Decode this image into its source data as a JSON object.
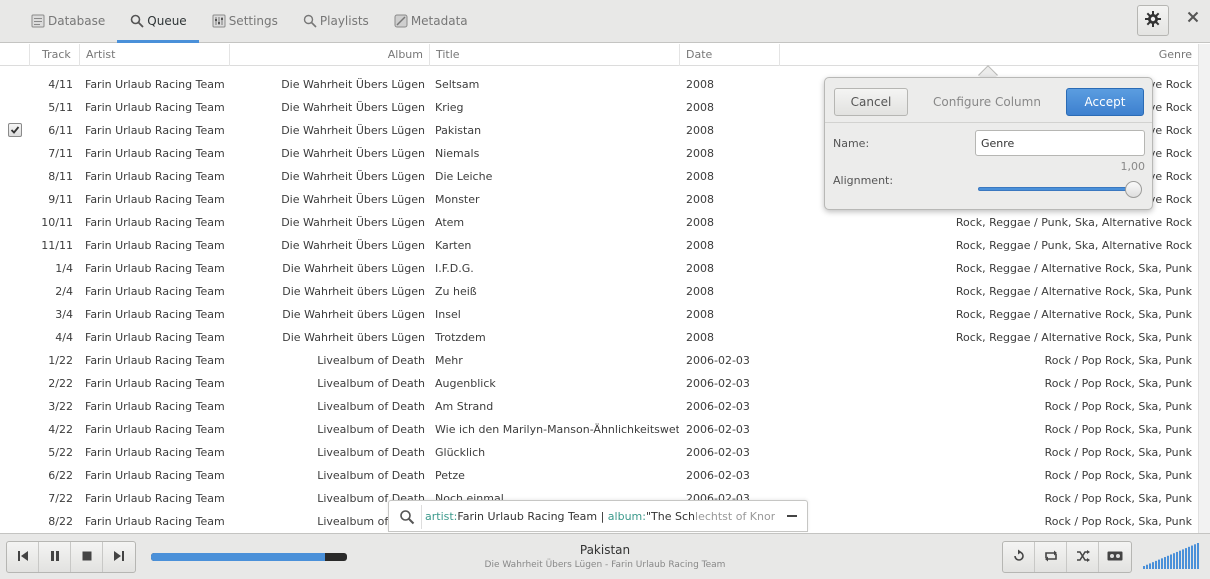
{
  "tabs": [
    {
      "label": "Database",
      "icon": "database-icon"
    },
    {
      "label": "Queue",
      "icon": "search-icon",
      "active": true
    },
    {
      "label": "Settings",
      "icon": "settings-icon"
    },
    {
      "label": "Playlists",
      "icon": "playlists-icon"
    },
    {
      "label": "Metadata",
      "icon": "metadata-icon"
    }
  ],
  "columns": {
    "track": "Track",
    "artist": "Artist",
    "album": "Album",
    "title": "Title",
    "date": "Date",
    "genre": "Genre"
  },
  "rows": [
    {
      "track": "4/11",
      "artist": "Farin Urlaub Racing Team",
      "album": "Die Wahrheit Übers Lügen",
      "title": "Seltsam",
      "date": "2008",
      "genre": "Rock, Reggae / Punk, Ska, Alternative Rock",
      "checked": false
    },
    {
      "track": "5/11",
      "artist": "Farin Urlaub Racing Team",
      "album": "Die Wahrheit Übers Lügen",
      "title": "Krieg",
      "date": "2008",
      "genre": "Rock, Reggae / Punk, Ska, Alternative Rock",
      "checked": false
    },
    {
      "track": "6/11",
      "artist": "Farin Urlaub Racing Team",
      "album": "Die Wahrheit Übers Lügen",
      "title": "Pakistan",
      "date": "2008",
      "genre": "Rock, Reggae / Punk, Ska, Alternative Rock",
      "checked": true
    },
    {
      "track": "7/11",
      "artist": "Farin Urlaub Racing Team",
      "album": "Die Wahrheit Übers Lügen",
      "title": "Niemals",
      "date": "2008",
      "genre": "Rock, Reggae / Punk, Ska, Alternative Rock",
      "checked": false
    },
    {
      "track": "8/11",
      "artist": "Farin Urlaub Racing Team",
      "album": "Die Wahrheit Übers Lügen",
      "title": "Die Leiche",
      "date": "2008",
      "genre": "Rock, Reggae / Punk, Ska, Alternative Rock",
      "checked": false
    },
    {
      "track": "9/11",
      "artist": "Farin Urlaub Racing Team",
      "album": "Die Wahrheit Übers Lügen",
      "title": "Monster",
      "date": "2008",
      "genre": "Rock, Reggae / Punk, Ska, Alternative Rock",
      "checked": false
    },
    {
      "track": "10/11",
      "artist": "Farin Urlaub Racing Team",
      "album": "Die Wahrheit Übers Lügen",
      "title": "Atem",
      "date": "2008",
      "genre": "Rock, Reggae / Punk, Ska, Alternative Rock",
      "checked": false
    },
    {
      "track": "11/11",
      "artist": "Farin Urlaub Racing Team",
      "album": "Die Wahrheit Übers Lügen",
      "title": "Karten",
      "date": "2008",
      "genre": "Rock, Reggae / Punk, Ska, Alternative Rock",
      "checked": false
    },
    {
      "track": "1/4",
      "artist": "Farin Urlaub Racing Team",
      "album": "Die Wahrheit übers Lügen",
      "title": "I.F.D.G.",
      "date": "2008",
      "genre": "Rock, Reggae / Alternative Rock, Ska, Punk",
      "checked": false
    },
    {
      "track": "2/4",
      "artist": "Farin Urlaub Racing Team",
      "album": "Die Wahrheit übers Lügen",
      "title": "Zu heiß",
      "date": "2008",
      "genre": "Rock, Reggae / Alternative Rock, Ska, Punk",
      "checked": false
    },
    {
      "track": "3/4",
      "artist": "Farin Urlaub Racing Team",
      "album": "Die Wahrheit übers Lügen",
      "title": "Insel",
      "date": "2008",
      "genre": "Rock, Reggae / Alternative Rock, Ska, Punk",
      "checked": false
    },
    {
      "track": "4/4",
      "artist": "Farin Urlaub Racing Team",
      "album": "Die Wahrheit übers Lügen",
      "title": "Trotzdem",
      "date": "2008",
      "genre": "Rock, Reggae / Alternative Rock, Ska, Punk",
      "checked": false
    },
    {
      "track": "1/22",
      "artist": "Farin Urlaub Racing Team",
      "album": "Livealbum of Death",
      "title": "Mehr",
      "date": "2006-02-03",
      "genre": "Rock / Pop Rock, Ska, Punk",
      "checked": false
    },
    {
      "track": "2/22",
      "artist": "Farin Urlaub Racing Team",
      "album": "Livealbum of Death",
      "title": "Augenblick",
      "date": "2006-02-03",
      "genre": "Rock / Pop Rock, Ska, Punk",
      "checked": false
    },
    {
      "track": "3/22",
      "artist": "Farin Urlaub Racing Team",
      "album": "Livealbum of Death",
      "title": "Am Strand",
      "date": "2006-02-03",
      "genre": "Rock / Pop Rock, Ska, Punk",
      "checked": false
    },
    {
      "track": "4/22",
      "artist": "Farin Urlaub Racing Team",
      "album": "Livealbum of Death",
      "title": "Wie ich den Marilyn-Manson-Ähnlichkeitswettbe",
      "date": "2006-02-03",
      "genre": "Rock / Pop Rock, Ska, Punk",
      "checked": false
    },
    {
      "track": "5/22",
      "artist": "Farin Urlaub Racing Team",
      "album": "Livealbum of Death",
      "title": "Glücklich",
      "date": "2006-02-03",
      "genre": "Rock / Pop Rock, Ska, Punk",
      "checked": false
    },
    {
      "track": "6/22",
      "artist": "Farin Urlaub Racing Team",
      "album": "Livealbum of Death",
      "title": "Petze",
      "date": "2006-02-03",
      "genre": "Rock / Pop Rock, Ska, Punk",
      "checked": false
    },
    {
      "track": "7/22",
      "artist": "Farin Urlaub Racing Team",
      "album": "Livealbum of Death",
      "title": "Noch einmal",
      "date": "2006-02-03",
      "genre": "Rock / Pop Rock, Ska, Punk",
      "checked": false
    },
    {
      "track": "8/22",
      "artist": "Farin Urlaub Racing Team",
      "album": "Livealbum of Death",
      "title": "",
      "date": "",
      "genre": "Rock / Pop Rock, Ska, Punk",
      "checked": false
    }
  ],
  "popover": {
    "cancel_label": "Cancel",
    "title": "Configure Column",
    "accept_label": "Accept",
    "name_label": "Name:",
    "name_value": "Genre",
    "alignment_label": "Alignment:",
    "alignment_value": "1,00",
    "alignment_fraction": 1.0
  },
  "search": {
    "kw1": "artist:",
    "val1": "Farin Urlaub Racing Team",
    "sep": " | ",
    "kw2": "album:",
    "val2": "\"The Sch",
    "val2_faded": "lechtst of Knorkator"
  },
  "player": {
    "now_title": "Pakistan",
    "now_subtitle": "Die Wahrheit Übers Lügen - Farin Urlaub Racing Team",
    "progress_fraction": 0.89
  },
  "colors": {
    "accent": "#4a90d9",
    "search_keyword": "#3c9a8c"
  }
}
